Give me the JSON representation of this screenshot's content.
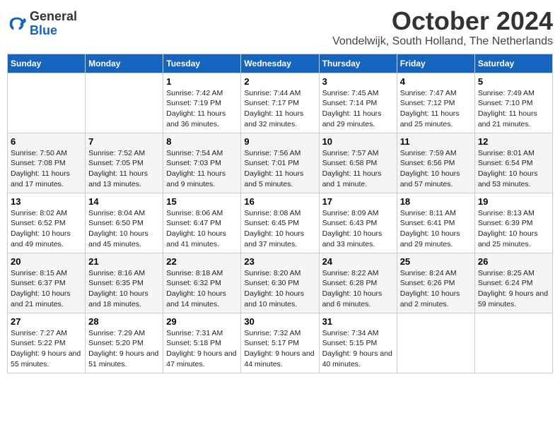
{
  "header": {
    "logo_line1": "General",
    "logo_line2": "Blue",
    "month": "October 2024",
    "location": "Vondelwijk, South Holland, The Netherlands"
  },
  "weekdays": [
    "Sunday",
    "Monday",
    "Tuesday",
    "Wednesday",
    "Thursday",
    "Friday",
    "Saturday"
  ],
  "weeks": [
    [
      {
        "day": "",
        "info": ""
      },
      {
        "day": "",
        "info": ""
      },
      {
        "day": "1",
        "info": "Sunrise: 7:42 AM\nSunset: 7:19 PM\nDaylight: 11 hours and 36 minutes."
      },
      {
        "day": "2",
        "info": "Sunrise: 7:44 AM\nSunset: 7:17 PM\nDaylight: 11 hours and 32 minutes."
      },
      {
        "day": "3",
        "info": "Sunrise: 7:45 AM\nSunset: 7:14 PM\nDaylight: 11 hours and 29 minutes."
      },
      {
        "day": "4",
        "info": "Sunrise: 7:47 AM\nSunset: 7:12 PM\nDaylight: 11 hours and 25 minutes."
      },
      {
        "day": "5",
        "info": "Sunrise: 7:49 AM\nSunset: 7:10 PM\nDaylight: 11 hours and 21 minutes."
      }
    ],
    [
      {
        "day": "6",
        "info": "Sunrise: 7:50 AM\nSunset: 7:08 PM\nDaylight: 11 hours and 17 minutes."
      },
      {
        "day": "7",
        "info": "Sunrise: 7:52 AM\nSunset: 7:05 PM\nDaylight: 11 hours and 13 minutes."
      },
      {
        "day": "8",
        "info": "Sunrise: 7:54 AM\nSunset: 7:03 PM\nDaylight: 11 hours and 9 minutes."
      },
      {
        "day": "9",
        "info": "Sunrise: 7:56 AM\nSunset: 7:01 PM\nDaylight: 11 hours and 5 minutes."
      },
      {
        "day": "10",
        "info": "Sunrise: 7:57 AM\nSunset: 6:58 PM\nDaylight: 11 hours and 1 minute."
      },
      {
        "day": "11",
        "info": "Sunrise: 7:59 AM\nSunset: 6:56 PM\nDaylight: 10 hours and 57 minutes."
      },
      {
        "day": "12",
        "info": "Sunrise: 8:01 AM\nSunset: 6:54 PM\nDaylight: 10 hours and 53 minutes."
      }
    ],
    [
      {
        "day": "13",
        "info": "Sunrise: 8:02 AM\nSunset: 6:52 PM\nDaylight: 10 hours and 49 minutes."
      },
      {
        "day": "14",
        "info": "Sunrise: 8:04 AM\nSunset: 6:50 PM\nDaylight: 10 hours and 45 minutes."
      },
      {
        "day": "15",
        "info": "Sunrise: 8:06 AM\nSunset: 6:47 PM\nDaylight: 10 hours and 41 minutes."
      },
      {
        "day": "16",
        "info": "Sunrise: 8:08 AM\nSunset: 6:45 PM\nDaylight: 10 hours and 37 minutes."
      },
      {
        "day": "17",
        "info": "Sunrise: 8:09 AM\nSunset: 6:43 PM\nDaylight: 10 hours and 33 minutes."
      },
      {
        "day": "18",
        "info": "Sunrise: 8:11 AM\nSunset: 6:41 PM\nDaylight: 10 hours and 29 minutes."
      },
      {
        "day": "19",
        "info": "Sunrise: 8:13 AM\nSunset: 6:39 PM\nDaylight: 10 hours and 25 minutes."
      }
    ],
    [
      {
        "day": "20",
        "info": "Sunrise: 8:15 AM\nSunset: 6:37 PM\nDaylight: 10 hours and 21 minutes."
      },
      {
        "day": "21",
        "info": "Sunrise: 8:16 AM\nSunset: 6:35 PM\nDaylight: 10 hours and 18 minutes."
      },
      {
        "day": "22",
        "info": "Sunrise: 8:18 AM\nSunset: 6:32 PM\nDaylight: 10 hours and 14 minutes."
      },
      {
        "day": "23",
        "info": "Sunrise: 8:20 AM\nSunset: 6:30 PM\nDaylight: 10 hours and 10 minutes."
      },
      {
        "day": "24",
        "info": "Sunrise: 8:22 AM\nSunset: 6:28 PM\nDaylight: 10 hours and 6 minutes."
      },
      {
        "day": "25",
        "info": "Sunrise: 8:24 AM\nSunset: 6:26 PM\nDaylight: 10 hours and 2 minutes."
      },
      {
        "day": "26",
        "info": "Sunrise: 8:25 AM\nSunset: 6:24 PM\nDaylight: 9 hours and 59 minutes."
      }
    ],
    [
      {
        "day": "27",
        "info": "Sunrise: 7:27 AM\nSunset: 5:22 PM\nDaylight: 9 hours and 55 minutes."
      },
      {
        "day": "28",
        "info": "Sunrise: 7:29 AM\nSunset: 5:20 PM\nDaylight: 9 hours and 51 minutes."
      },
      {
        "day": "29",
        "info": "Sunrise: 7:31 AM\nSunset: 5:18 PM\nDaylight: 9 hours and 47 minutes."
      },
      {
        "day": "30",
        "info": "Sunrise: 7:32 AM\nSunset: 5:17 PM\nDaylight: 9 hours and 44 minutes."
      },
      {
        "day": "31",
        "info": "Sunrise: 7:34 AM\nSunset: 5:15 PM\nDaylight: 9 hours and 40 minutes."
      },
      {
        "day": "",
        "info": ""
      },
      {
        "day": "",
        "info": ""
      }
    ]
  ]
}
